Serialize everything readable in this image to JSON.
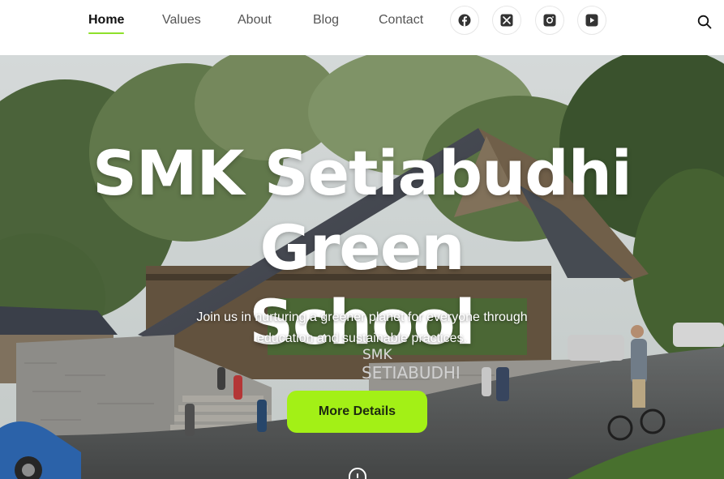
{
  "nav": {
    "items": [
      {
        "label": "Home",
        "active": true
      },
      {
        "label": "Values",
        "active": false
      },
      {
        "label": "About",
        "active": false
      },
      {
        "label": "Blog",
        "active": false
      },
      {
        "label": "Contact",
        "active": false
      }
    ],
    "social": [
      {
        "icon": "facebook-icon"
      },
      {
        "icon": "x-twitter-icon"
      },
      {
        "icon": "instagram-icon"
      },
      {
        "icon": "youtube-icon"
      }
    ],
    "search_icon": "search-icon",
    "accent_color": "#8ee02a"
  },
  "hero": {
    "title_line1": "SMK Setiabudhi Green",
    "title_line2": "School",
    "subtitle_line1": "Join us in nurturing a greener planet for everyone through",
    "subtitle_line2": "education and sustainable practices.",
    "cta_label": "More Details",
    "cta_color": "#a3f016",
    "building_sign_line1": "SMK",
    "building_sign_line2": "SETIABUDHI"
  }
}
